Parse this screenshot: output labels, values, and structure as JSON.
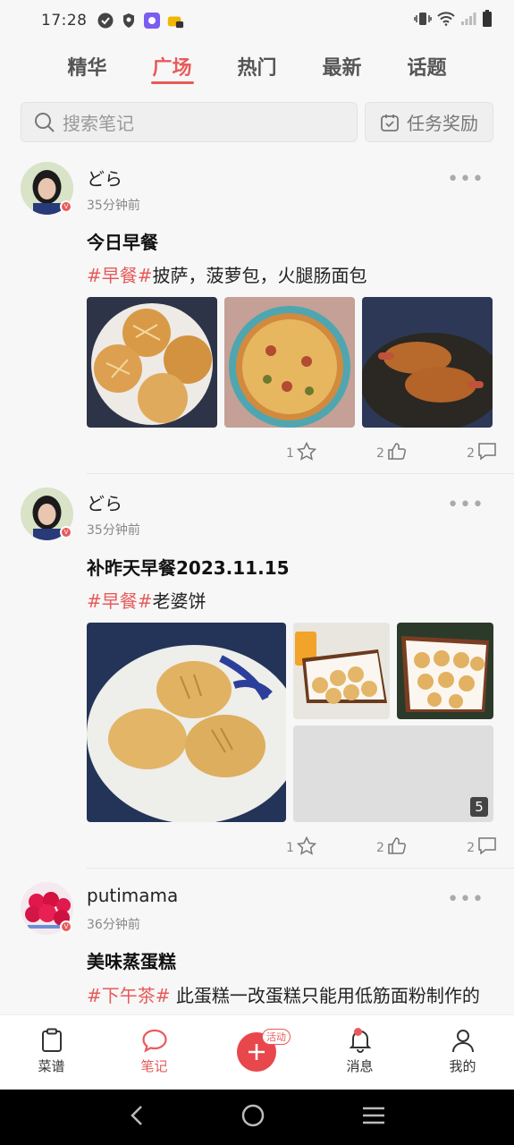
{
  "status_bar": {
    "time": "17:28"
  },
  "tabs": [
    {
      "label": "精华"
    },
    {
      "label": "广场"
    },
    {
      "label": "热门"
    },
    {
      "label": "最新"
    },
    {
      "label": "话题"
    }
  ],
  "search": {
    "placeholder": "搜索笔记",
    "task_label": "任务奖励"
  },
  "posts": [
    {
      "username": "どら",
      "time_ago": "35分钟前",
      "title": "今日早餐",
      "tag": "#早餐#",
      "text": "披萨，菠萝包，火腿肠面包",
      "stars": "1",
      "likes": "2",
      "comments": "2"
    },
    {
      "username": "どら",
      "time_ago": "35分钟前",
      "title": "补昨天早餐2023.11.15",
      "tag": "#早餐#",
      "text": "老婆饼",
      "more_count": "5",
      "stars": "1",
      "likes": "2",
      "comments": "2"
    },
    {
      "username": "putimama",
      "time_ago": "36分钟前",
      "title": "美味蒸蛋糕",
      "tag": "#下午茶#",
      "text": " 此蛋糕一改蛋糕只能用低筋面粉制作的"
    }
  ],
  "bottom_nav": {
    "recipes": "菜谱",
    "notes": "笔记",
    "activity_badge": "活动",
    "messages": "消息",
    "mine": "我的"
  },
  "colors": {
    "accent": "#e85a5a"
  }
}
